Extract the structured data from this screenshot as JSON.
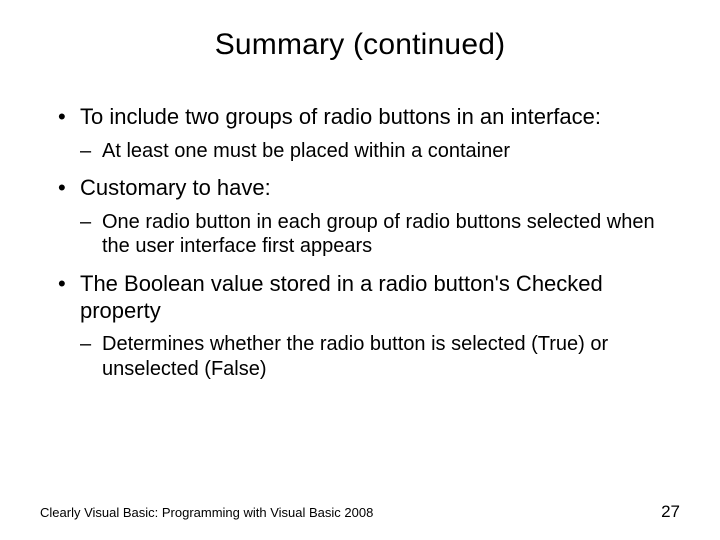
{
  "title": "Summary (continued)",
  "bullets": {
    "b1": "To include two groups of radio buttons in an interface:",
    "b1a": "At least one must be placed within a container",
    "b2": "Customary to have:",
    "b2a": "One radio button in each group of radio buttons selected when the user interface first appears",
    "b3": "The Boolean value stored in a radio button's Checked property",
    "b3a": "Determines whether the radio button is selected (True) or unselected (False)"
  },
  "footer": {
    "source": "Clearly Visual Basic: Programming with Visual Basic 2008",
    "page": "27"
  }
}
